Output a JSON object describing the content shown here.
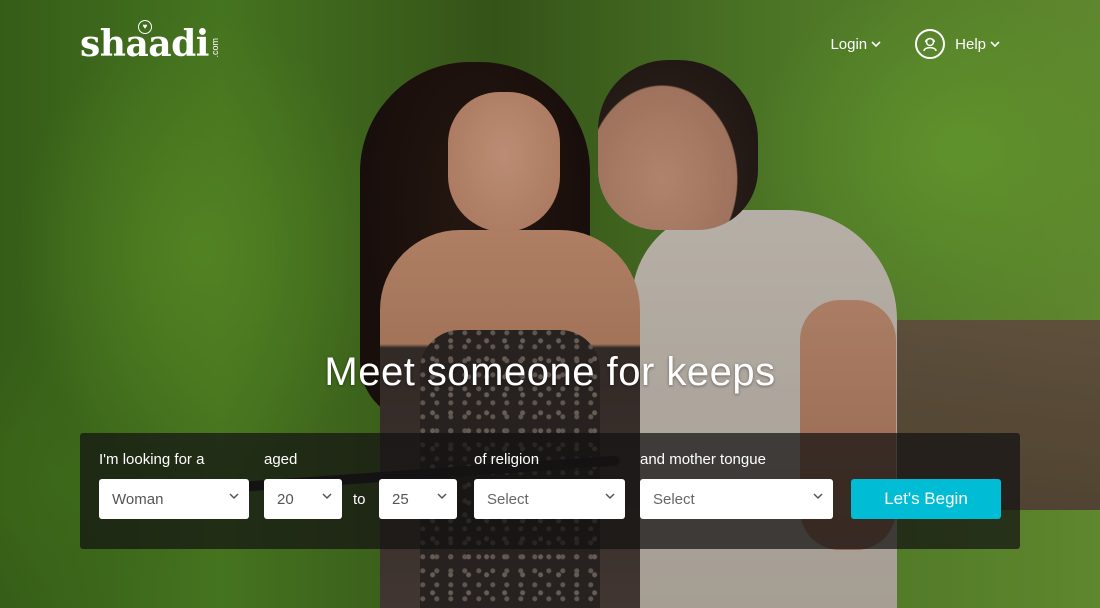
{
  "brand": {
    "logo_text": "shaadi",
    "logo_suffix": ".com"
  },
  "nav": {
    "login_label": "Login",
    "help_label": "Help"
  },
  "hero": {
    "headline": "Meet someone for keeps"
  },
  "search": {
    "looking_for_label": "I'm looking for a",
    "looking_for_value": "Woman",
    "aged_label": "aged",
    "age_from_value": "20",
    "to_label": "to",
    "age_to_value": "25",
    "religion_label": "of religion",
    "religion_value": "Select",
    "mother_tongue_label": "and mother tongue",
    "mother_tongue_value": "Select",
    "submit_label": "Let's Begin"
  },
  "colors": {
    "accent": "#00bcd5",
    "panel_bg": "rgba(20,18,18,0.72)"
  },
  "icons": {
    "chevron": "chevron-down-icon",
    "help_avatar": "user-headset-icon",
    "logo_heart": "heart-icon"
  }
}
